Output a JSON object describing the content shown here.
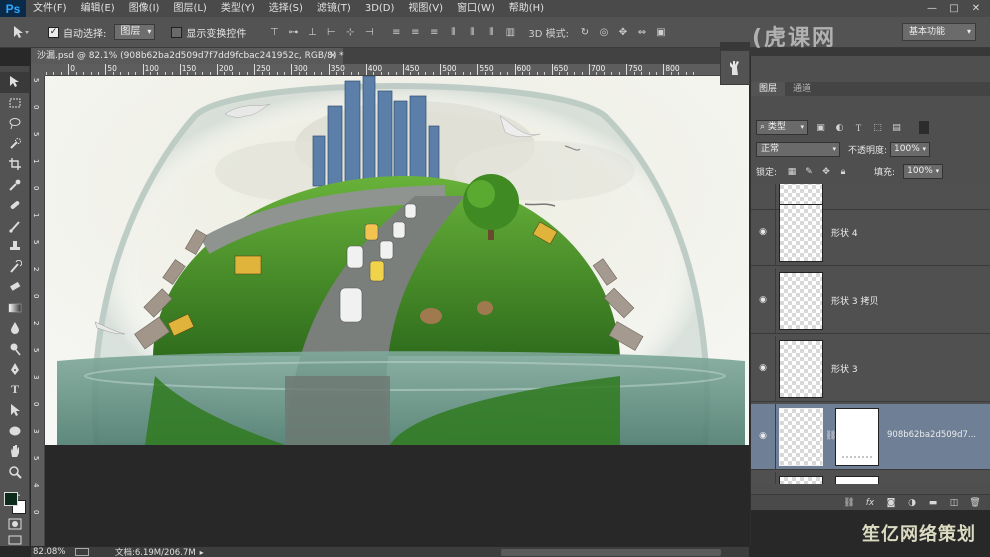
{
  "app": {
    "logo": "Ps",
    "menu": [
      "文件(F)",
      "编辑(E)",
      "图像(I)",
      "图层(L)",
      "类型(Y)",
      "选择(S)",
      "滤镜(T)",
      "3D(D)",
      "视图(V)",
      "窗口(W)",
      "帮助(H)"
    ],
    "window_controls": [
      "—",
      "□",
      "✕"
    ]
  },
  "options_bar": {
    "auto_select_label": "自动选择:",
    "auto_select_checked": true,
    "auto_select_target": "图层",
    "show_transform_label": "显示变换控件",
    "show_transform_checked": false,
    "mode_3d_label": "3D 模式:",
    "workspace": "基本功能"
  },
  "document": {
    "tab_title": "沙漏.psd @ 82.1% (908b62ba2d509d7f7dd9fcbac241952c, RGB/8) *",
    "close_glyph": "×"
  },
  "rulers": {
    "h_labels": [
      "50",
      "0",
      "50",
      "100",
      "150",
      "200",
      "250",
      "300",
      "350",
      "400",
      "450",
      "500",
      "550",
      "600",
      "650",
      "700",
      "750",
      "800"
    ],
    "v_labels": [
      "5",
      "0",
      "5",
      "1",
      "0",
      "1",
      "5",
      "2",
      "0",
      "2",
      "5",
      "3",
      "0",
      "3",
      "5",
      "4",
      "0"
    ]
  },
  "status_bar": {
    "zoom": "82.08%",
    "doc_size": "文档:6.19M/206.7M",
    "arrow": "▸"
  },
  "layers_panel": {
    "tabs": [
      "图层",
      "通道"
    ],
    "filter_kind": "类型",
    "blend_mode": "正常",
    "opacity_label": "不透明度:",
    "opacity": "100%",
    "lock_label": "锁定:",
    "fill_label": "填充:",
    "fill": "100%",
    "layers": [
      {
        "name": "",
        "visible": false,
        "selected": false,
        "has_mask": false
      },
      {
        "name": "形状 4",
        "visible": true,
        "selected": false,
        "has_mask": false
      },
      {
        "name": "形状 3 拷贝",
        "visible": true,
        "selected": false,
        "has_mask": false
      },
      {
        "name": "形状 3",
        "visible": true,
        "selected": false,
        "has_mask": false
      },
      {
        "name": "908b62ba2d509d7...",
        "visible": true,
        "selected": true,
        "has_mask": true
      },
      {
        "name": "",
        "visible": false,
        "selected": false,
        "has_mask": true
      }
    ],
    "footer_icons": [
      "link-icon",
      "fx-icon",
      "mask-icon",
      "adjustment-icon",
      "group-icon",
      "new-layer-icon",
      "trash-icon"
    ]
  },
  "watermarks": {
    "top": "(虎课网",
    "bottom": "笙亿网络策划"
  },
  "colors": {
    "chrome": "#535353",
    "selected_layer": "#6e7f96",
    "grass": "#3f8a2a",
    "water": "#5f8f83"
  }
}
